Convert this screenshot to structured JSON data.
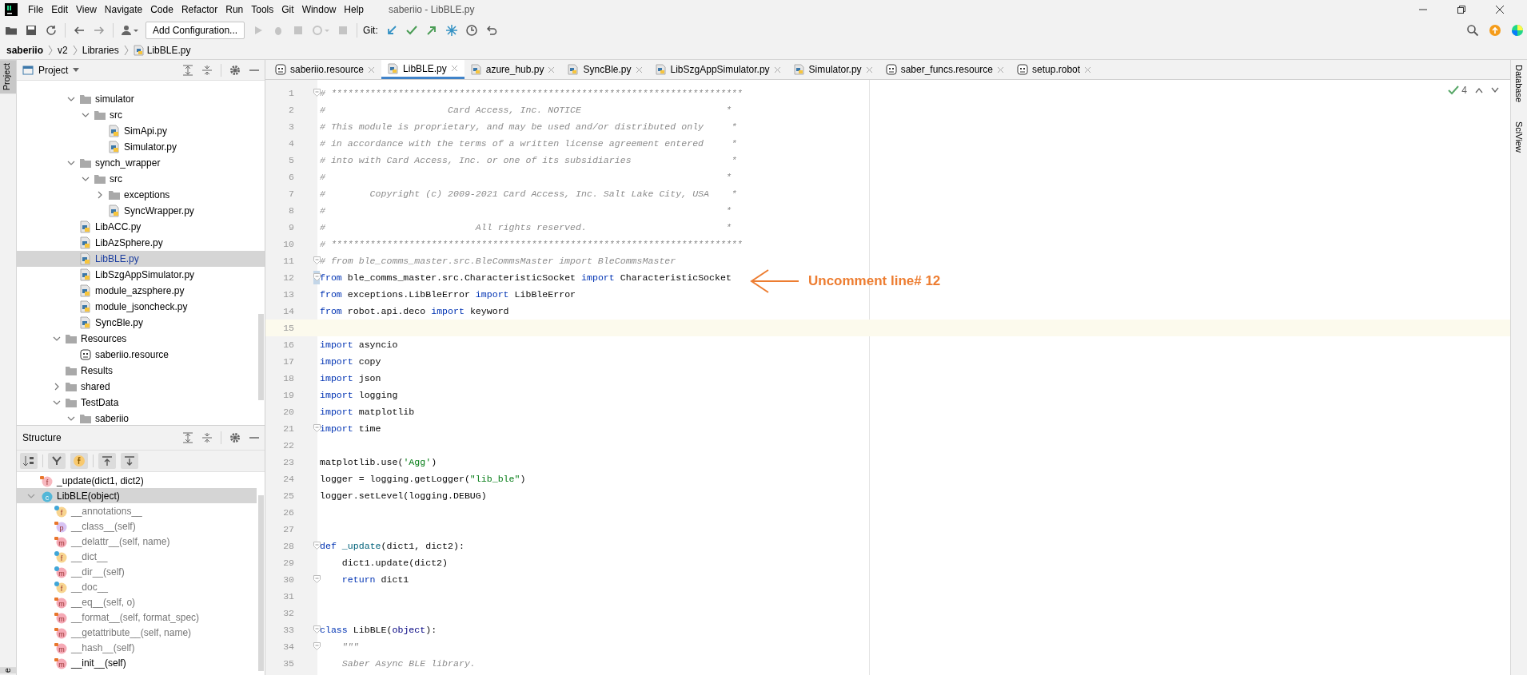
{
  "menu_bar": {
    "items": [
      "File",
      "Edit",
      "View",
      "Navigate",
      "Code",
      "Refactor",
      "Run",
      "Tools",
      "Git",
      "Window",
      "Help"
    ],
    "title": "saberiio - LibBLE.py"
  },
  "toolbar": {
    "run_config": "Add Configuration...",
    "git_label": "Git:"
  },
  "breadcrumb": [
    "saberiio",
    "v2",
    "Libraries",
    "LibBLE.py"
  ],
  "left_stripe": [
    "Project",
    "e"
  ],
  "right_stripe": [
    "Database",
    "SciView"
  ],
  "project": {
    "title": "Project",
    "tree": [
      {
        "children": [
          {
            "label": "simulator",
            "kind": "folder",
            "expanded": true,
            "selected": false,
            "children": [
              {
                "label": "src",
                "kind": "folder",
                "expanded": true,
                "selected": false,
                "children": [
                  {
                    "label": "SimApi.py",
                    "kind": "python",
                    "selected": false
                  },
                  {
                    "label": "Simulator.py",
                    "kind": "python",
                    "selected": false
                  }
                ]
              }
            ]
          },
          {
            "label": "synch_wrapper",
            "kind": "folder",
            "expanded": true,
            "selected": false,
            "children": [
              {
                "label": "src",
                "kind": "folder",
                "expanded": true,
                "selected": false,
                "children": [
                  {
                    "label": "exceptions",
                    "kind": "folder",
                    "expanded": false,
                    "selected": false
                  },
                  {
                    "label": "SyncWrapper.py",
                    "kind": "python",
                    "selected": false
                  }
                ]
              }
            ]
          },
          {
            "label": "LibACC.py",
            "kind": "python",
            "selected": false
          },
          {
            "label": "LibAzSphere.py",
            "kind": "python",
            "selected": false
          },
          {
            "label": "LibBLE.py",
            "kind": "python",
            "selected": true
          },
          {
            "label": "LibSzgAppSimulator.py",
            "kind": "python",
            "selected": false
          },
          {
            "label": "module_azsphere.py",
            "kind": "python",
            "selected": false
          },
          {
            "label": "module_jsoncheck.py",
            "kind": "python",
            "selected": false
          },
          {
            "label": "SyncBle.py",
            "kind": "python",
            "selected": false
          }
        ]
      },
      {
        "label": "Resources",
        "kind": "folder",
        "expanded": true,
        "selected": false,
        "children": [
          {
            "label": "saberiio.resource",
            "kind": "robot",
            "selected": false
          }
        ]
      },
      {
        "label": "Results",
        "kind": "folder",
        "selected": false
      },
      {
        "label": "shared",
        "kind": "folder",
        "expanded": false,
        "selected": false
      },
      {
        "label": "TestData",
        "kind": "folder",
        "expanded": true,
        "selected": false,
        "children": [
          {
            "label": "saberiio",
            "kind": "folder",
            "expanded": true,
            "selected": false
          }
        ]
      }
    ]
  },
  "structure": {
    "title": "Structure",
    "items": [
      {
        "label": "_update(dict1, dict2)",
        "kind": "function",
        "icon_letter": "f",
        "locked": true,
        "dotted": false,
        "inherited": false,
        "selected": false
      },
      {
        "label": "LibBLE(object)",
        "kind": "class",
        "icon_letter": "c",
        "locked": false,
        "dotted": false,
        "expanded": true,
        "inherited": false,
        "selected": true,
        "children": [
          {
            "label": "__annotations__",
            "kind": "field",
            "icon_letter": "f",
            "locked": false,
            "dotted": true,
            "inherited": true,
            "selected": false
          },
          {
            "label": "__class__(self)",
            "kind": "property",
            "icon_letter": "p",
            "locked": true,
            "dotted": false,
            "inherited": true,
            "selected": false
          },
          {
            "label": "__delattr__(self, name)",
            "kind": "method",
            "icon_letter": "m",
            "locked": true,
            "dotted": false,
            "inherited": true,
            "selected": false
          },
          {
            "label": "__dict__",
            "kind": "field",
            "icon_letter": "f",
            "locked": false,
            "dotted": true,
            "inherited": true,
            "selected": false
          },
          {
            "label": "__dir__(self)",
            "kind": "method",
            "icon_letter": "m",
            "locked": false,
            "dotted": true,
            "inherited": true,
            "selected": false
          },
          {
            "label": "__doc__",
            "kind": "field",
            "icon_letter": "f",
            "locked": false,
            "dotted": true,
            "inherited": true,
            "selected": false
          },
          {
            "label": "__eq__(self, o)",
            "kind": "method",
            "icon_letter": "m",
            "locked": true,
            "dotted": false,
            "inherited": true,
            "selected": false
          },
          {
            "label": "__format__(self, format_spec)",
            "kind": "method",
            "icon_letter": "m",
            "locked": true,
            "dotted": false,
            "inherited": true,
            "selected": false
          },
          {
            "label": "__getattribute__(self, name)",
            "kind": "method",
            "icon_letter": "m",
            "locked": true,
            "dotted": false,
            "inherited": true,
            "selected": false
          },
          {
            "label": "__hash__(self)",
            "kind": "method",
            "icon_letter": "m",
            "locked": true,
            "dotted": false,
            "inherited": true,
            "selected": false
          },
          {
            "label": "__init__(self)",
            "kind": "method",
            "icon_letter": "m",
            "locked": true,
            "dotted": false,
            "inherited": false,
            "selected": false
          }
        ]
      }
    ]
  },
  "tabs": [
    {
      "label": "saberiio.resource",
      "kind": "robot",
      "selected": false
    },
    {
      "label": "LibBLE.py",
      "kind": "python",
      "selected": true
    },
    {
      "label": "azure_hub.py",
      "kind": "python",
      "selected": false
    },
    {
      "label": "SyncBle.py",
      "kind": "python",
      "selected": false
    },
    {
      "label": "LibSzgAppSimulator.py",
      "kind": "python",
      "selected": false
    },
    {
      "label": "Simulator.py",
      "kind": "python",
      "selected": false
    },
    {
      "label": "saber_funcs.resource",
      "kind": "robot",
      "selected": false
    },
    {
      "label": "setup.robot",
      "kind": "robot",
      "selected": false
    }
  ],
  "inspection": {
    "count": "4"
  },
  "code": [
    {
      "number": "1",
      "fold": true,
      "tokens": [
        {
          "kind": "comment",
          "text": "# **************************************************************************"
        }
      ]
    },
    {
      "number": "2",
      "tokens": [
        {
          "kind": "comment",
          "text": "#                      Card Access, Inc. NOTICE                          *"
        }
      ]
    },
    {
      "number": "3",
      "tokens": [
        {
          "kind": "comment",
          "text": "# This module is proprietary, and may be used and/or distributed only     *"
        }
      ]
    },
    {
      "number": "4",
      "tokens": [
        {
          "kind": "comment",
          "text": "# in accordance with the terms of a written license agreement entered     *"
        }
      ]
    },
    {
      "number": "5",
      "tokens": [
        {
          "kind": "comment",
          "text": "# into with Card Access, Inc. or one of its subsidiaries                  *"
        }
      ]
    },
    {
      "number": "6",
      "tokens": [
        {
          "kind": "comment",
          "text": "#                                                                        *"
        }
      ]
    },
    {
      "number": "7",
      "tokens": [
        {
          "kind": "comment",
          "text": "#        Copyright (c) 2009-2021 Card Access, Inc. Salt Lake City, USA    *"
        }
      ]
    },
    {
      "number": "8",
      "tokens": [
        {
          "kind": "comment",
          "text": "#                                                                        *"
        }
      ]
    },
    {
      "number": "9",
      "tokens": [
        {
          "kind": "comment",
          "text": "#                           All rights reserved.                         *"
        }
      ]
    },
    {
      "number": "10",
      "tokens": [
        {
          "kind": "comment",
          "text": "# **************************************************************************"
        }
      ]
    },
    {
      "number": "11",
      "fold": true,
      "tokens": [
        {
          "kind": "comment",
          "text": "# from ble_comms_master.src.BleCommsMaster import BleCommsMaster"
        }
      ]
    },
    {
      "number": "12",
      "fold": true,
      "changed": true,
      "tokens": [
        {
          "kind": "keyword",
          "text": "from"
        },
        {
          "kind": "plain",
          "text": " ble_comms_master.src.CharacteristicSocket "
        },
        {
          "kind": "keyword",
          "text": "import"
        },
        {
          "kind": "plain",
          "text": " CharacteristicSocket"
        }
      ]
    },
    {
      "number": "13",
      "tokens": [
        {
          "kind": "keyword",
          "text": "from"
        },
        {
          "kind": "plain",
          "text": " exceptions.LibBleError "
        },
        {
          "kind": "keyword",
          "text": "import"
        },
        {
          "kind": "plain",
          "text": " LibBleError"
        }
      ]
    },
    {
      "number": "14",
      "tokens": [
        {
          "kind": "keyword",
          "text": "from"
        },
        {
          "kind": "plain",
          "text": " robot.api.deco "
        },
        {
          "kind": "keyword",
          "text": "import"
        },
        {
          "kind": "plain",
          "text": " keyword"
        }
      ]
    },
    {
      "number": "15",
      "current": true
    },
    {
      "number": "16",
      "tokens": [
        {
          "kind": "keyword",
          "text": "import"
        },
        {
          "kind": "plain",
          "text": " asyncio"
        }
      ]
    },
    {
      "number": "17",
      "tokens": [
        {
          "kind": "keyword",
          "text": "import"
        },
        {
          "kind": "plain",
          "text": " copy"
        }
      ]
    },
    {
      "number": "18",
      "tokens": [
        {
          "kind": "keyword",
          "text": "import"
        },
        {
          "kind": "plain",
          "text": " json"
        }
      ]
    },
    {
      "number": "19",
      "tokens": [
        {
          "kind": "keyword",
          "text": "import"
        },
        {
          "kind": "plain",
          "text": " logging"
        }
      ]
    },
    {
      "number": "20",
      "tokens": [
        {
          "kind": "keyword",
          "text": "import"
        },
        {
          "kind": "plain",
          "text": " matplotlib"
        }
      ]
    },
    {
      "number": "21",
      "fold": true,
      "tokens": [
        {
          "kind": "keyword",
          "text": "import"
        },
        {
          "kind": "plain",
          "text": " time"
        }
      ]
    },
    {
      "number": "22"
    },
    {
      "number": "23",
      "tokens": [
        {
          "kind": "plain",
          "text": "matplotlib.use("
        },
        {
          "kind": "string",
          "text": "'Agg'"
        },
        {
          "kind": "plain",
          "text": ")"
        }
      ]
    },
    {
      "number": "24",
      "tokens": [
        {
          "kind": "plain",
          "text": "logger = logging.getLogger("
        },
        {
          "kind": "string",
          "text": "\"lib_ble\""
        },
        {
          "kind": "plain",
          "text": ")"
        }
      ]
    },
    {
      "number": "25",
      "tokens": [
        {
          "kind": "plain",
          "text": "logger.setLevel(logging.DEBUG)"
        }
      ]
    },
    {
      "number": "26"
    },
    {
      "number": "27"
    },
    {
      "number": "28",
      "fold": true,
      "tokens": [
        {
          "kind": "keyword",
          "text": "def "
        },
        {
          "kind": "function",
          "text": "_update"
        },
        {
          "kind": "plain",
          "text": "(dict1, dict2):"
        }
      ]
    },
    {
      "number": "29",
      "tokens": [
        {
          "kind": "plain",
          "text": "    dict1.update(dict2)"
        }
      ]
    },
    {
      "number": "30",
      "fold": true,
      "tokens": [
        {
          "kind": "keyword",
          "text": "    return"
        },
        {
          "kind": "plain",
          "text": " dict1"
        }
      ]
    },
    {
      "number": "31"
    },
    {
      "number": "32"
    },
    {
      "number": "33",
      "fold": true,
      "tokens": [
        {
          "kind": "keyword",
          "text": "class"
        },
        {
          "kind": "plain",
          "text": " LibBLE("
        },
        {
          "kind": "builtin",
          "text": "object"
        },
        {
          "kind": "plain",
          "text": "):"
        }
      ]
    },
    {
      "number": "34",
      "fold": true,
      "tokens": [
        {
          "kind": "doc",
          "text": "    \"\"\""
        }
      ]
    },
    {
      "number": "35",
      "tokens": [
        {
          "kind": "doc",
          "text": "    Saber Async BLE library."
        }
      ]
    }
  ],
  "annotation": {
    "text": "Uncomment line# 12",
    "color": "#ed7d31"
  }
}
